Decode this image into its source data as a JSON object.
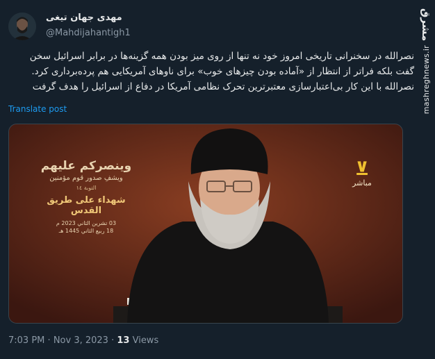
{
  "author": {
    "display_name": "مهدی جهان تیغی",
    "handle": "@Mahdijahantigh1"
  },
  "watermark": {
    "logo": "مشرق",
    "site": "mashreghnews.ir"
  },
  "tweet": {
    "lines": [
      "نصرالله در سخنرانی تاریخی امروز خود نه تنها از روی میز بودن همه گزینه‌ها در برابر اسرائیل سخن",
      "گفت بلکه فراتر از انتظار از «آماده بودن چیزهای خوب» برای ناوهای آمریکایی هم پرده‌برداری کرد.",
      "نصرالله با این کار بی‌اعتبارسازی معتبرترین تحرک نظامی آمریکا در دفاع از اسرائیل را هدف گرفت"
    ],
    "translate_label": "Translate post"
  },
  "media": {
    "banner_line1": "وينصركم عليهم",
    "banner_line2": "ويشفِ صدور قوم مؤمنين",
    "banner_line3": "التوبة ١٤",
    "banner_line4": "شهداء على طريق القدس",
    "banner_date1": "03 تشرين الثاني 2023 م",
    "banner_date2": "18 ربيع الثاني 1445 هـ",
    "live_label": "مباشر"
  },
  "footer": {
    "time": "7:03 PM",
    "separator": "·",
    "date": "Nov 3, 2023",
    "views_count": "13",
    "views_label": "Views"
  }
}
